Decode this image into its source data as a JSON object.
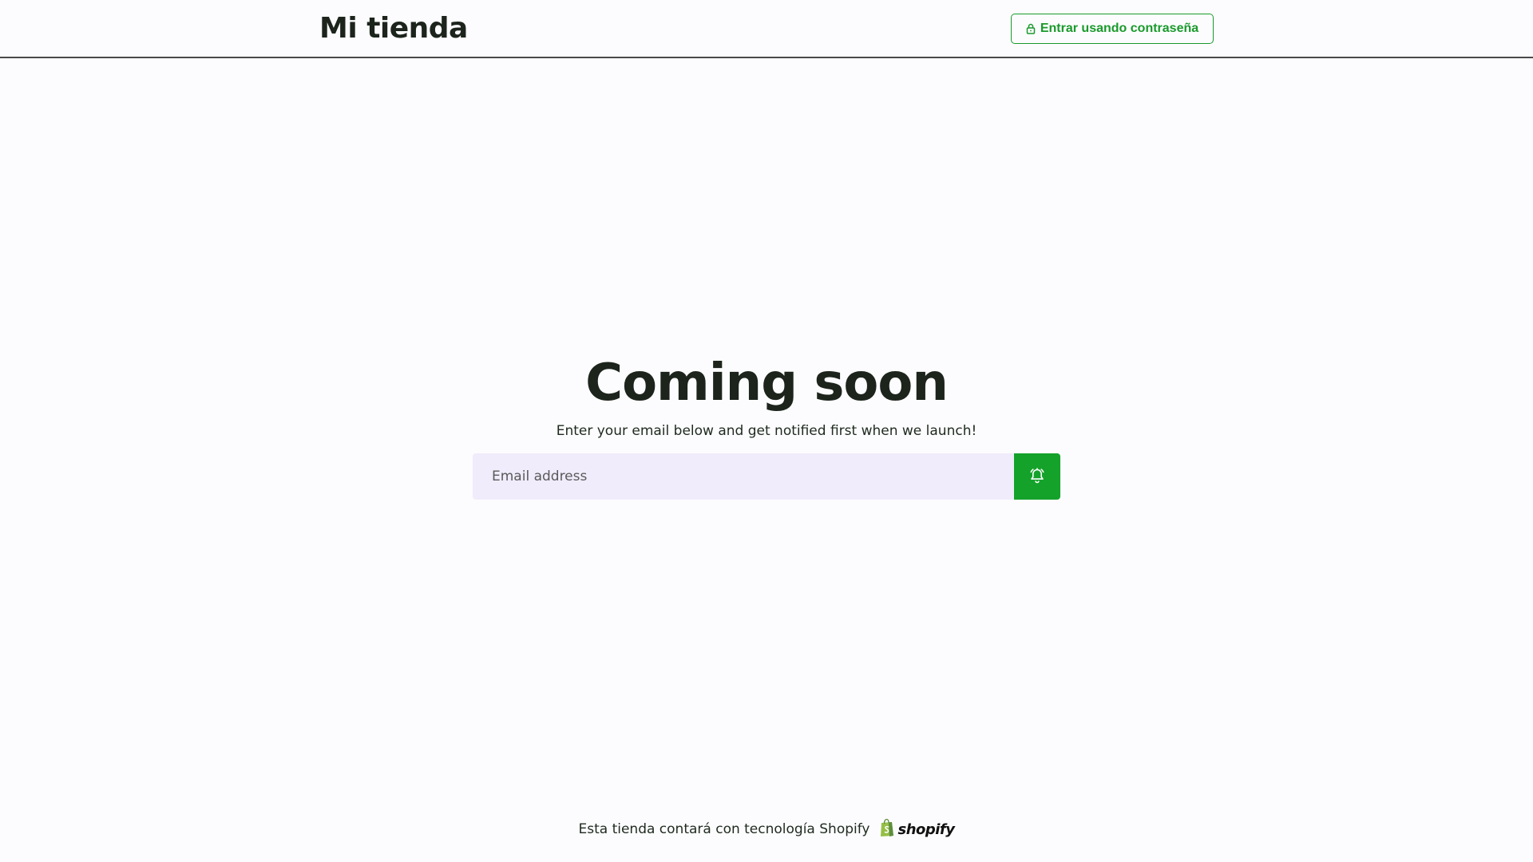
{
  "header": {
    "store_title": "Mi tienda",
    "password_button_label": "Entrar usando contraseña",
    "password_button_icon": "lock-icon"
  },
  "main": {
    "title": "Coming soon",
    "subtitle": "Enter your email below and get notified first when we launch!",
    "email_placeholder": "Email address",
    "email_value": "",
    "notify_button_icon": "bell-icon"
  },
  "footer": {
    "powered_by_text": "Esta tienda contará con tecnología Shopify",
    "logo_wordmark": "shopify"
  },
  "colors": {
    "accent_green": "#14a22a",
    "input_background": "#f0ecfb",
    "page_background": "#fcfcfe",
    "text_dark": "#1c241c"
  }
}
